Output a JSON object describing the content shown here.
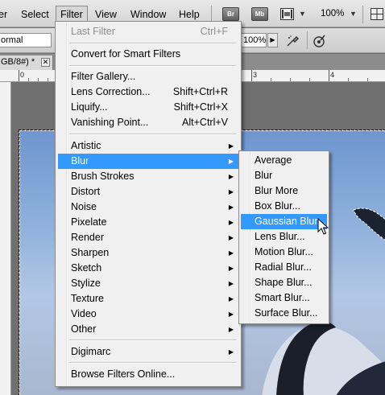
{
  "menubar": {
    "items": [
      "er",
      "Select",
      "Filter",
      "View",
      "Window",
      "Help"
    ],
    "app_buttons": [
      "Br",
      "Mb"
    ],
    "zoom": "100%"
  },
  "options": {
    "mode": "ormal",
    "opacity": "100%"
  },
  "document": {
    "tab_label": "GB/8#) *",
    "close": "✕",
    "ruler_numbers": [
      "0",
      "3",
      "4"
    ]
  },
  "filter_menu": {
    "last_filter": {
      "label": "Last Filter",
      "shortcut": "Ctrl+F"
    },
    "convert": "Convert for Smart Filters",
    "gallery": "Filter Gallery...",
    "lens": {
      "label": "Lens Correction...",
      "shortcut": "Shift+Ctrl+R"
    },
    "liquify": {
      "label": "Liquify...",
      "shortcut": "Shift+Ctrl+X"
    },
    "vanishing": {
      "label": "Vanishing Point...",
      "shortcut": "Alt+Ctrl+V"
    },
    "submenus": [
      "Artistic",
      "Blur",
      "Brush Strokes",
      "Distort",
      "Noise",
      "Pixelate",
      "Render",
      "Sharpen",
      "Sketch",
      "Stylize",
      "Texture",
      "Video",
      "Other"
    ],
    "digimarc": "Digimarc",
    "browse": "Browse Filters Online..."
  },
  "blur_menu": {
    "items": [
      "Average",
      "Blur",
      "Blur More",
      "Box Blur...",
      "Gaussian Blur...",
      "Lens Blur...",
      "Motion Blur...",
      "Radial Blur...",
      "Shape Blur...",
      "Smart Blur...",
      "Surface Blur..."
    ]
  },
  "colors": {
    "highlight": "#3399ff",
    "menu_bg": "#f0f0f0"
  }
}
